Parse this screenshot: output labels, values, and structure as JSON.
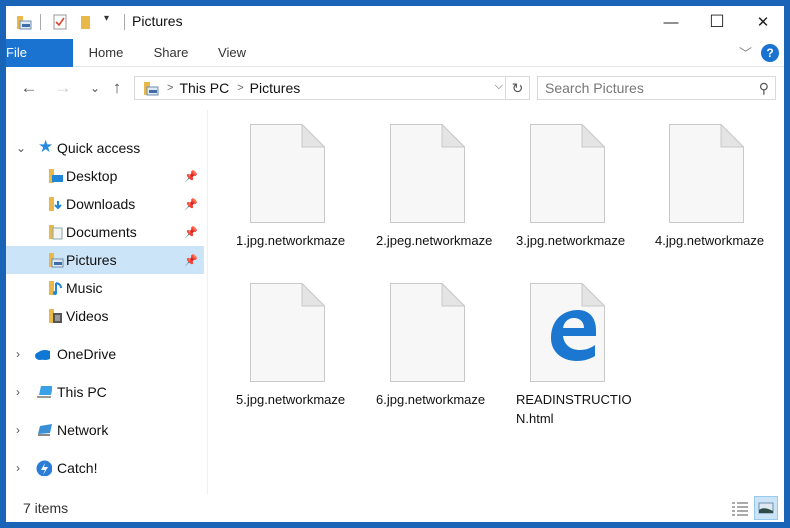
{
  "window": {
    "title": "Pictures",
    "controls": {
      "minimize": "—",
      "maximize": "☐",
      "close": "✕"
    }
  },
  "ribbon": {
    "tabs": [
      "File",
      "Home",
      "Share",
      "View"
    ],
    "help": "?"
  },
  "navigation": {
    "back_icon": "←",
    "forward_icon": "→",
    "recent_icon": "⌄",
    "up_icon": "↑",
    "breadcrumb": [
      "This PC",
      "Pictures"
    ],
    "search_placeholder": "Search Pictures"
  },
  "sidebar": {
    "items": [
      {
        "label": "Quick access",
        "icon": "star-icon",
        "expand": "expanded"
      },
      {
        "label": "Desktop",
        "icon": "desktop-folder-icon",
        "pinned": true
      },
      {
        "label": "Downloads",
        "icon": "downloads-folder-icon",
        "pinned": true
      },
      {
        "label": "Documents",
        "icon": "documents-folder-icon",
        "pinned": true
      },
      {
        "label": "Pictures",
        "icon": "pictures-folder-icon",
        "pinned": true,
        "selected": true
      },
      {
        "label": "Music",
        "icon": "music-folder-icon"
      },
      {
        "label": "Videos",
        "icon": "videos-folder-icon"
      },
      {
        "label": "OneDrive",
        "icon": "onedrive-cloud-icon",
        "expand": "collapsed"
      },
      {
        "label": "This PC",
        "icon": "computer-icon",
        "expand": "collapsed"
      },
      {
        "label": "Network",
        "icon": "network-icon",
        "expand": "collapsed"
      },
      {
        "label": "Catch!",
        "icon": "catch-icon",
        "expand": "collapsed"
      }
    ]
  },
  "files": [
    {
      "name": "1.jpg.networkmaze",
      "icon": "blank-file-icon"
    },
    {
      "name": "2.jpeg.networkmaze",
      "icon": "blank-file-icon"
    },
    {
      "name": "3.jpg.networkmaze",
      "icon": "blank-file-icon"
    },
    {
      "name": "4.jpg.networkmaze",
      "icon": "blank-file-icon"
    },
    {
      "name": "5.jpg.networkmaze",
      "icon": "blank-file-icon"
    },
    {
      "name": "6.jpg.networkmaze",
      "icon": "blank-file-icon"
    },
    {
      "name": "READINSTRUCTION.html",
      "icon": "edge-html-file-icon"
    }
  ],
  "status": {
    "item_count": "7 items",
    "active_view": "large-icons"
  },
  "colors": {
    "accent": "#1a73d0",
    "selection": "#cce4f7",
    "border": "#1a64b8"
  }
}
